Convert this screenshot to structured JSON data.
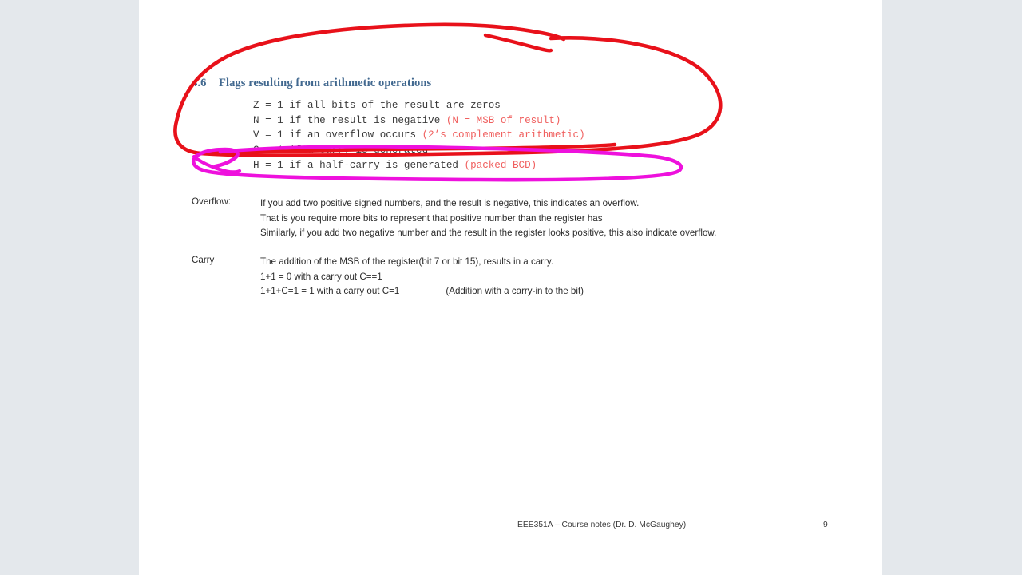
{
  "document": {
    "page_background": "#e4e8ec",
    "page_color": "#ffffff"
  },
  "slide": {
    "heading": {
      "number": "4.6",
      "title": "Flags resulting from arithmetic operations",
      "color": "#41688f"
    },
    "flags_code": [
      {
        "main": "Z = 1 if all bits of the result are zeros",
        "note": ""
      },
      {
        "main": "N = 1 if the result is negative ",
        "note": "(N = MSB of result)"
      },
      {
        "main": "V = 1 if an overflow occurs ",
        "note": "(2’s complement arithmetic)"
      },
      {
        "main": "C = 1 if a carry is generated",
        "note": ""
      },
      {
        "main": "H = 1 if a half-carry is generated ",
        "note": "(packed BCD)"
      }
    ],
    "code_note_color": "#f0605f",
    "overflow": {
      "label": "Overflow:",
      "lines": [
        "If you add two positive signed numbers, and the result is negative, this indicates an overflow.",
        "That is you require more bits to represent that positive number than the register has",
        "Similarly, if you add two negative number and the result in the register looks positive, this also indicate overflow."
      ]
    },
    "carry": {
      "label": "Carry",
      "lines": [
        "The addition of the MSB of the register(bit 7 or bit 15), results in a carry.",
        "1+1 = 0 with a carry out C==1"
      ],
      "last_line": "1+1+C=1 = 1 with a carry out C=1",
      "last_line_aside": "(Addition with a carry-in to the bit)"
    },
    "footer": {
      "text": "EEE351A – Course notes (Dr. D. McGaughey)",
      "page_number": "9"
    }
  },
  "annotations": [
    {
      "name": "red-ellipse",
      "shape": "hand-drawn-ellipse",
      "color": "#e8111a",
      "stroke_width": 4.5,
      "encircles": "section-4.6-heading-and-flag-list"
    },
    {
      "name": "magenta-ellipse",
      "shape": "hand-drawn-ellipse",
      "color": "#ee11dd",
      "stroke_width": 4.5,
      "encircles": "half-carry-flag-line"
    }
  ]
}
